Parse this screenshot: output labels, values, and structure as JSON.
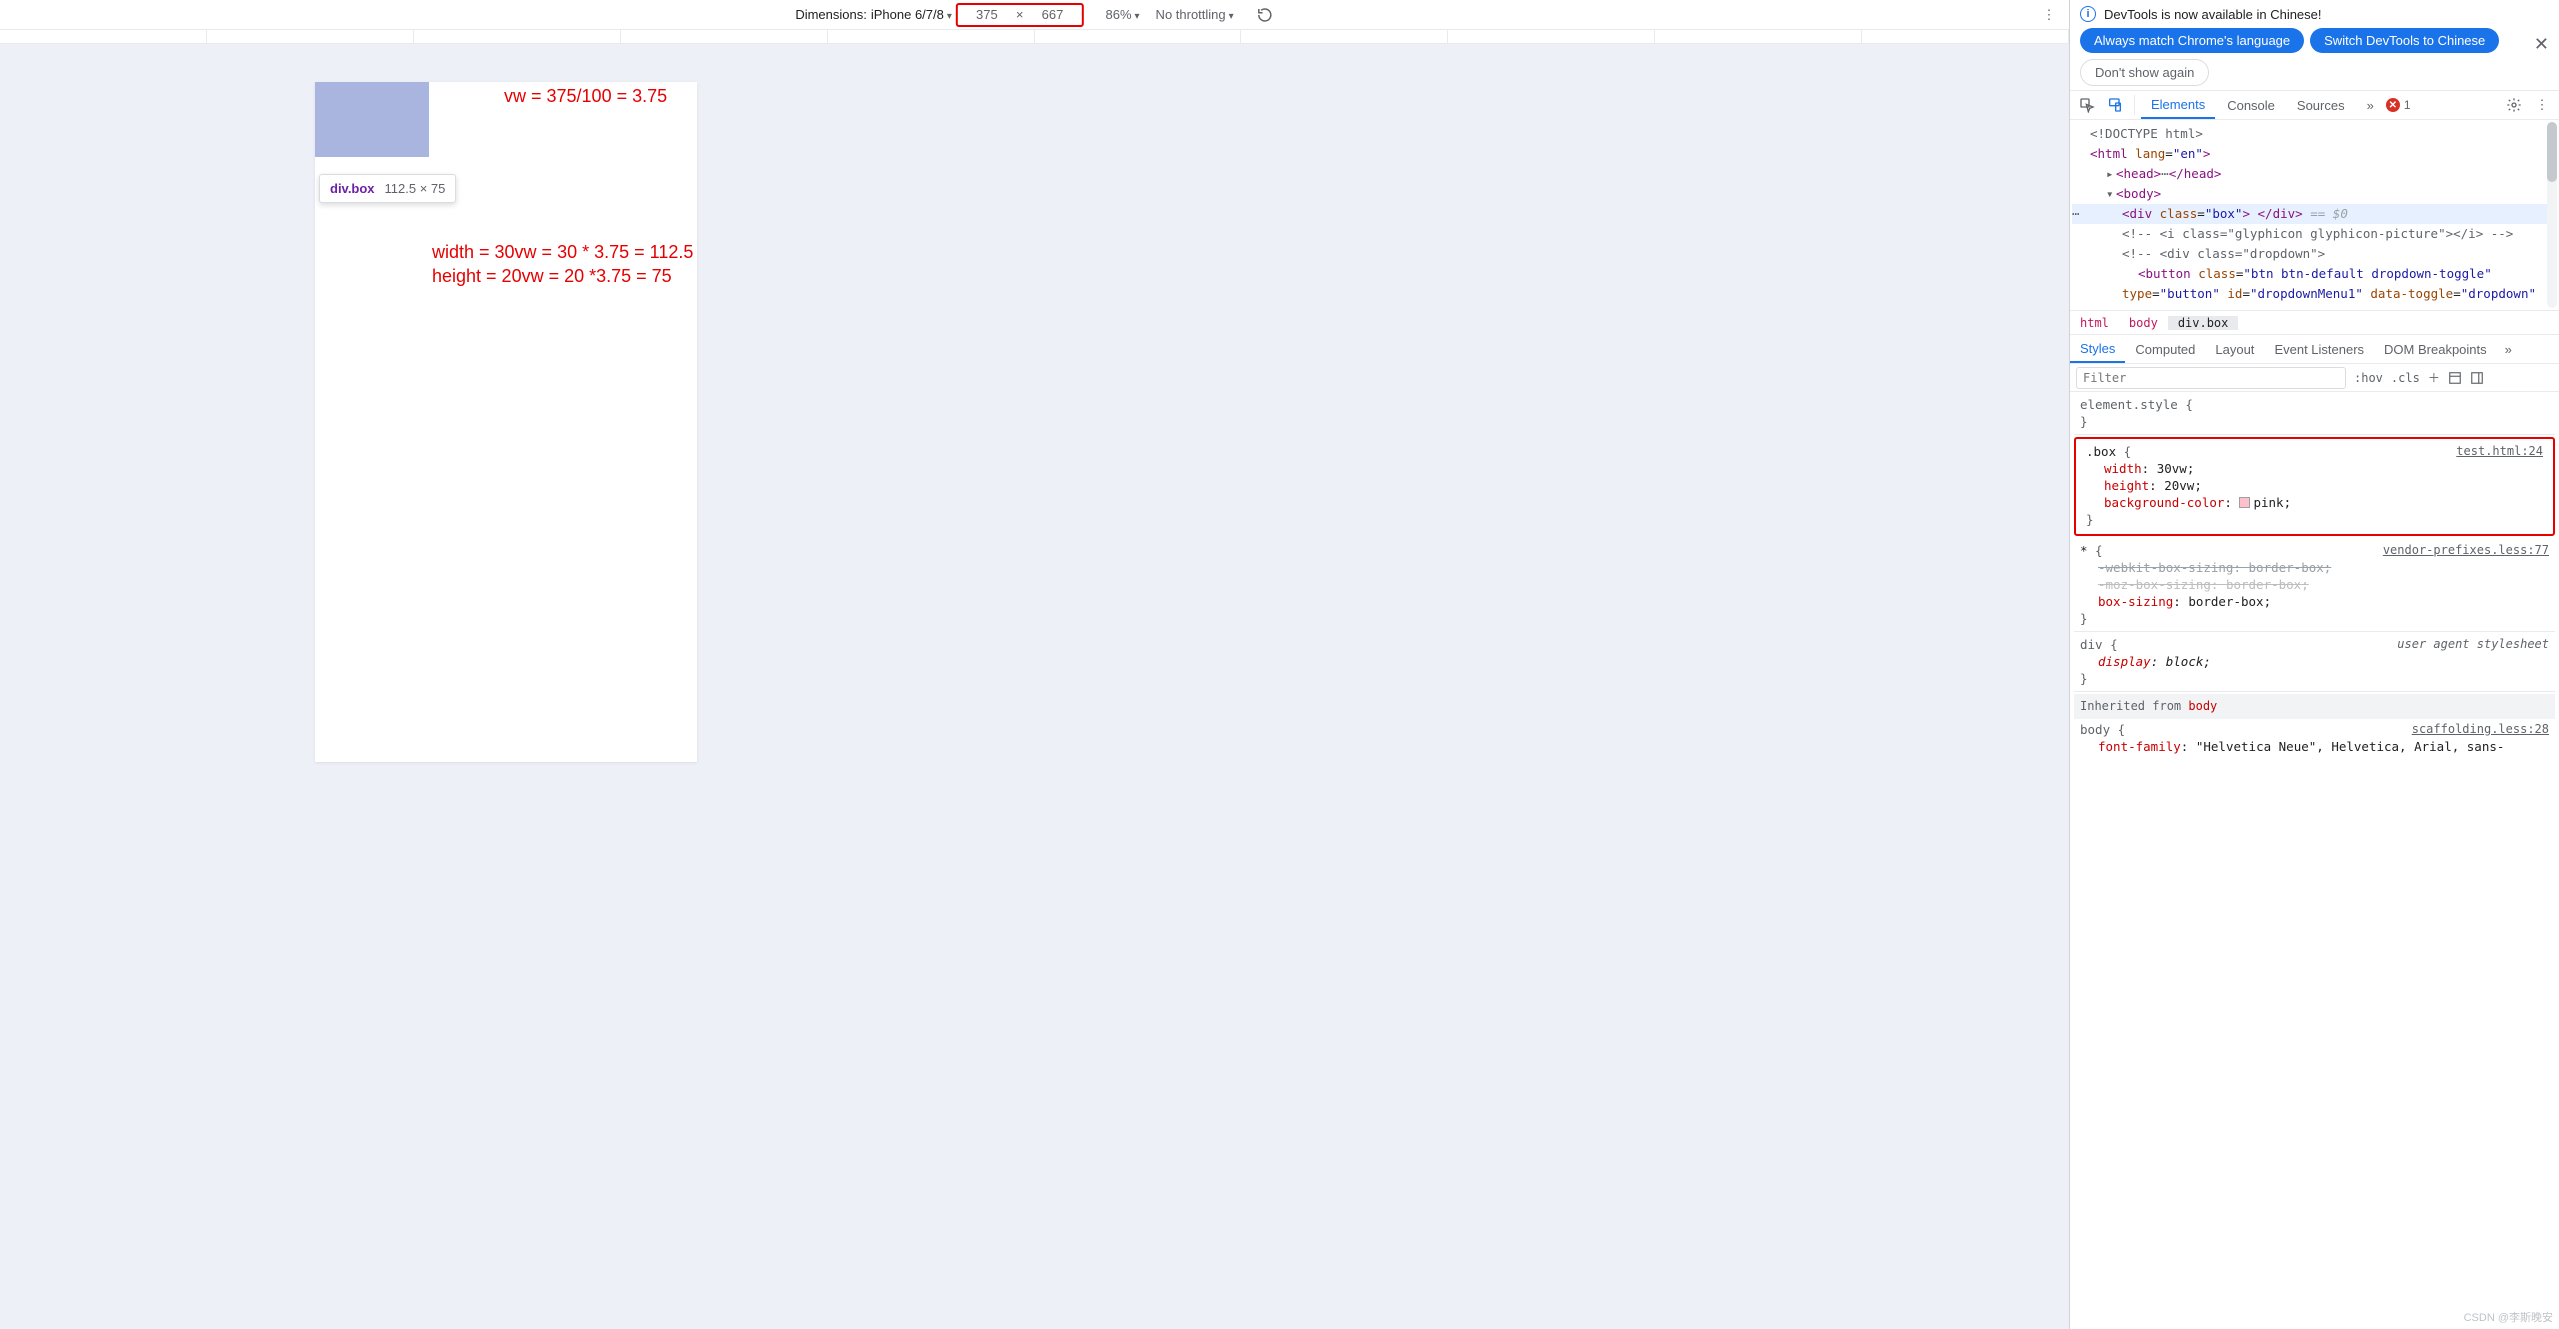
{
  "emu": {
    "dimensions_label": "Dimensions:",
    "device": "iPhone 6/7/8",
    "width": "375",
    "times": "×",
    "height": "667",
    "zoom": "86%",
    "throttle": "No throttling"
  },
  "viewport": {
    "tooltip_selector": "div.box",
    "tooltip_dims": "112.5 × 75"
  },
  "annotations": {
    "vw": "vw = 375/100 = 3.75",
    "width": "width = 30vw = 30 * 3.75 = 112.5",
    "height": "height = 20vw = 20 *3.75 = 75"
  },
  "infobar": {
    "message": "DevTools is now available in Chinese!",
    "btn_match": "Always match Chrome's language",
    "btn_switch": "Switch DevTools to Chinese",
    "btn_dismiss": "Don't show again"
  },
  "tabs": {
    "elements": "Elements",
    "console": "Console",
    "sources": "Sources",
    "errors": "1"
  },
  "dom": {
    "l0": "<!DOCTYPE html>",
    "l1_open": "<html lang=\"en\">",
    "l2_head": "<head>…</head>",
    "l3_body": "<body>",
    "l4_div": "<div class=\"box\"> </div>",
    "l4_eq": " == $0",
    "l5_cmt": "<!-- <i class=\"glyphicon glyphicon-picture\"></i> -->",
    "l6_cmt": "<!-- <div class=\"dropdown\">",
    "l7": "<button class=\"btn btn-default dropdown-toggle\"",
    "l8": "type=\"button\" id=\"dropdownMenu1\" data-toggle=\"dropdown\""
  },
  "crumbs": {
    "c0": "html",
    "c1": "body",
    "c2": "div.box"
  },
  "styles_tabs": {
    "styles": "Styles",
    "computed": "Computed",
    "layout": "Layout",
    "listeners": "Event Listeners",
    "dom_bp": "DOM Breakpoints"
  },
  "filter": {
    "placeholder": "Filter",
    "hov": ":hov",
    "cls": ".cls"
  },
  "rules": {
    "elstyle_sel": "element.style",
    "box": {
      "selector": ".box",
      "src": "test.html:24",
      "width_n": "width",
      "width_v": "30vw",
      "height_n": "height",
      "height_v": "20vw",
      "bg_n": "background-color",
      "bg_v": "pink",
      "bg_swatch": "#ffc0cb"
    },
    "star": {
      "selector": "*",
      "src": "vendor-prefixes.less:77",
      "p1n": "-webkit-box-sizing",
      "p1v": "border-box",
      "p2n": "-moz-box-sizing",
      "p2v": "border-box",
      "p3n": "box-sizing",
      "p3v": "border-box"
    },
    "div_ua": {
      "selector": "div",
      "src": "user agent stylesheet",
      "p1n": "display",
      "p1v": "block"
    },
    "inherit_label": "Inherited from ",
    "inherit_from": "body",
    "body": {
      "selector": "body",
      "src": "scaffolding.less:28",
      "p1n": "font-family",
      "p1v": "\"Helvetica Neue\", Helvetica, Arial, sans-"
    }
  },
  "watermark": "CSDN @李斯晚安"
}
